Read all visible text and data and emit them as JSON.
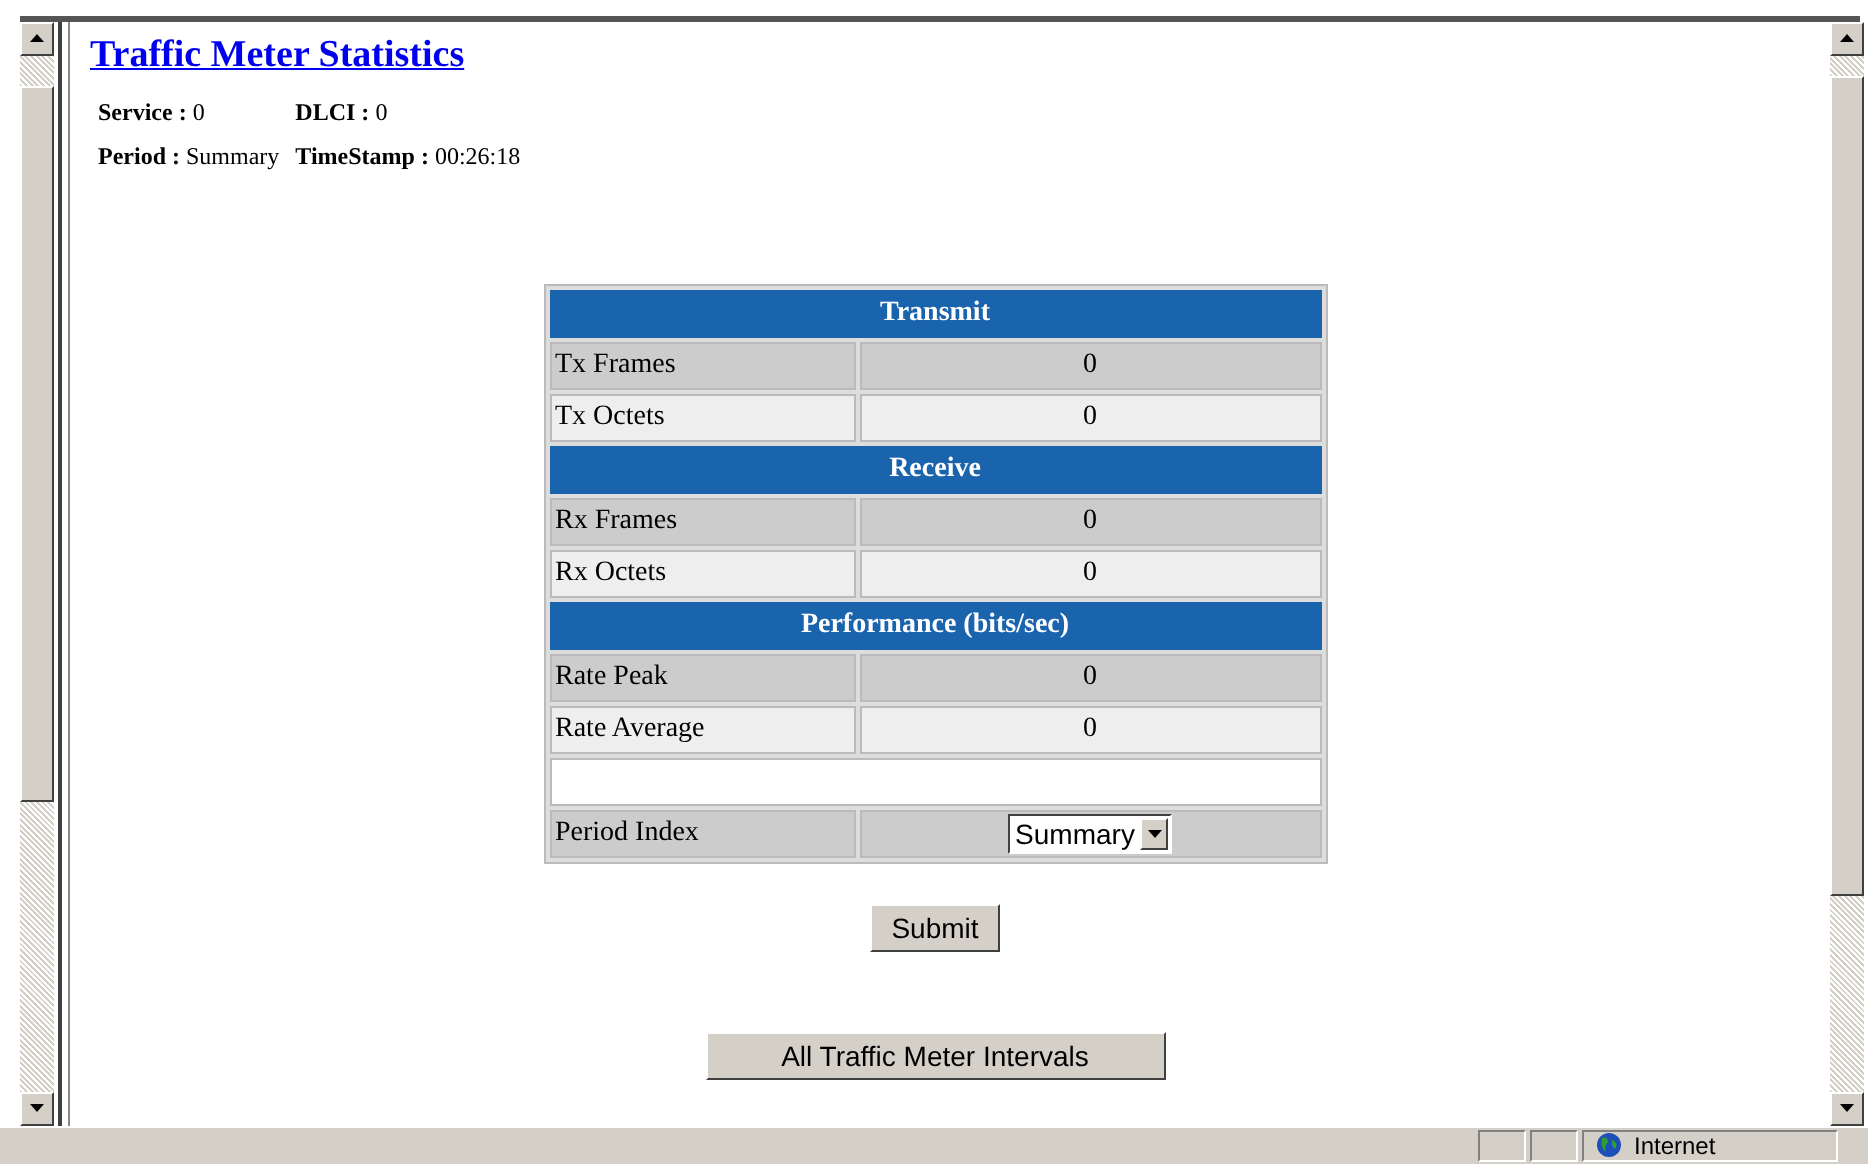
{
  "title": "Traffic Meter Statistics",
  "info": [
    [
      {
        "label": "Service :",
        "value": "0"
      },
      {
        "label": "DLCI :",
        "value": "0"
      }
    ],
    [
      {
        "label": "Period :",
        "value": "Summary"
      },
      {
        "label": "TimeStamp :",
        "value": "00:26:18"
      }
    ]
  ],
  "sections": [
    {
      "heading": "Transmit",
      "rows": [
        {
          "label": "Tx Frames",
          "value": "0"
        },
        {
          "label": "Tx Octets",
          "value": "0"
        }
      ]
    },
    {
      "heading": "Receive",
      "rows": [
        {
          "label": "Rx Frames",
          "value": "0"
        },
        {
          "label": "Rx Octets",
          "value": "0"
        }
      ]
    },
    {
      "heading": "Performance (bits/sec)",
      "rows": [
        {
          "label": "Rate Peak",
          "value": "0"
        },
        {
          "label": "Rate Average",
          "value": "0"
        }
      ]
    }
  ],
  "period_index": {
    "label": "Period Index",
    "value": "Summary"
  },
  "submit": "Submit",
  "intervals": "All Traffic Meter Intervals",
  "status_bar": {
    "zone": "Internet"
  }
}
